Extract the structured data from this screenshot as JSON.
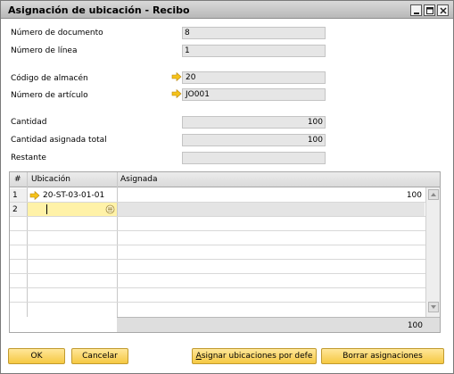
{
  "window": {
    "title": "Asignación de ubicación - Recibo"
  },
  "header": {
    "doc_number": {
      "label": "Número de documento",
      "value": "8"
    },
    "line_number": {
      "label": "Número de línea",
      "value": "1"
    },
    "warehouse_code": {
      "label": "Código de almacén",
      "value": "20"
    },
    "item_number": {
      "label": "Número de artículo",
      "value": "JO001"
    },
    "quantity": {
      "label": "Cantidad",
      "value": "100"
    },
    "total_assigned": {
      "label": "Cantidad asignada total",
      "value": "100"
    },
    "remaining": {
      "label": "Restante",
      "value": ""
    }
  },
  "grid": {
    "columns": [
      "#",
      "Ubicación",
      "Asignada"
    ],
    "rows": [
      {
        "num": "1",
        "location": "20-ST-03-01-01",
        "assigned": "100"
      },
      {
        "num": "2",
        "location": "",
        "assigned": ""
      }
    ],
    "total": "100"
  },
  "buttons": {
    "ok": "OK",
    "cancel": "Cancelar",
    "default_assign": "Asignar ubicaciones por defe",
    "default_assign_accel": "A",
    "clear": "Borrar asignaciones"
  },
  "colors": {
    "button_fill": "#f5c842",
    "selected_row": "#fff2a8",
    "arrow": "#f0b400"
  },
  "icons": [
    "minimize-icon",
    "maximize-icon",
    "close-icon",
    "link-arrow-icon",
    "list-picker-icon",
    "scroll-up-icon",
    "scroll-down-icon"
  ]
}
